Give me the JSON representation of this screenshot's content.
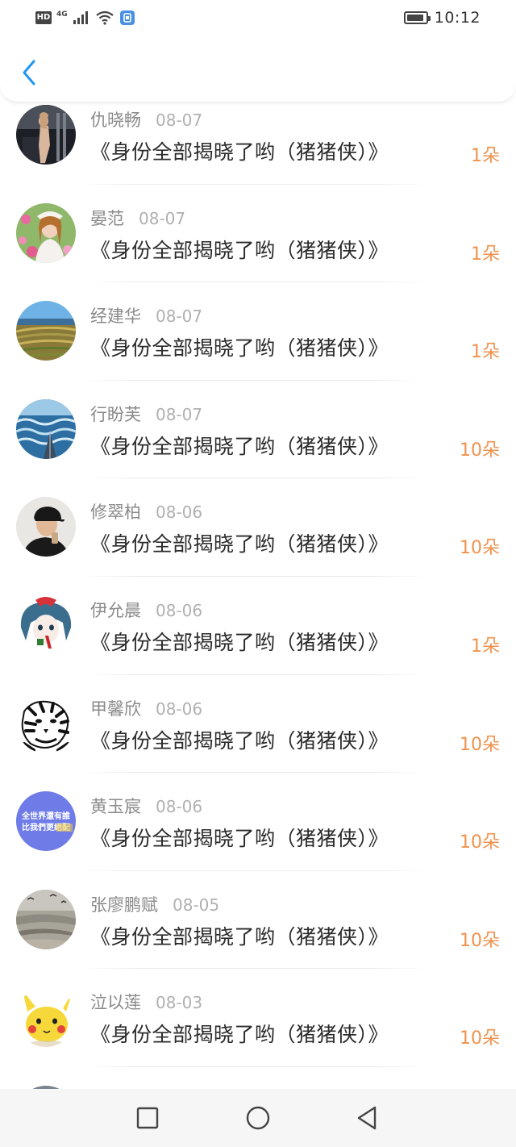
{
  "status_bar": {
    "hd_badge": "HD",
    "network_type": "4G",
    "time": "10:12",
    "battery_level_percent": 90,
    "icons": [
      "signal-icon",
      "wifi-icon",
      "app-notification-icon",
      "battery-icon"
    ]
  },
  "header": {
    "back_icon": "chevron-left-icon",
    "accent_color": "#2196F3"
  },
  "colors": {
    "amount": "#f0924c",
    "name": "#8a8a8a",
    "date": "#b0b0b0",
    "title": "#2b2b2b"
  },
  "gifts": [
    {
      "name": "仇晓畅",
      "date": "08-07",
      "title": "《身份全部揭晓了哟（猪猪侠）》",
      "amount": "1朵",
      "avatar": "gym-photo-avatar"
    },
    {
      "name": "晏范",
      "date": "08-07",
      "title": "《身份全部揭晓了哟（猪猪侠）》",
      "amount": "1朵",
      "avatar": "woman-flowers-avatar"
    },
    {
      "name": "经建华",
      "date": "08-07",
      "title": "《身份全部揭晓了哟（猪猪侠）》",
      "amount": "1朵",
      "avatar": "rice-terrace-avatar"
    },
    {
      "name": "行盼芙",
      "date": "08-07",
      "title": "《身份全部揭晓了哟（猪猪侠）》",
      "amount": "10朵",
      "avatar": "ocean-waves-avatar"
    },
    {
      "name": "修翠柏",
      "date": "08-06",
      "title": "《身份全部揭晓了哟（猪猪侠）》",
      "amount": "10朵",
      "avatar": "man-cap-avatar"
    },
    {
      "name": "伊允晨",
      "date": "08-06",
      "title": "《身份全部揭晓了哟（猪猪侠）》",
      "amount": "1朵",
      "avatar": "anime-character-avatar"
    },
    {
      "name": "甲馨欣",
      "date": "08-06",
      "title": "《身份全部揭晓了哟（猪猪侠）》",
      "amount": "10朵",
      "avatar": "tiger-sketch-avatar"
    },
    {
      "name": "黄玉宸",
      "date": "08-06",
      "title": "《身份全部揭晓了哟（猪猪侠）》",
      "amount": "10朵",
      "avatar": "text-image-avatar",
      "avatar_text": [
        "全世界還有誰",
        "比我們更絕配"
      ]
    },
    {
      "name": "张廖鹏赋",
      "date": "08-05",
      "title": "《身份全部揭晓了哟（猪猪侠）》",
      "amount": "10朵",
      "avatar": "beach-birds-avatar"
    },
    {
      "name": "泣以莲",
      "date": "08-03",
      "title": "《身份全部揭晓了哟（猪猪侠）》",
      "amount": "10朵",
      "avatar": "pikachu-avatar"
    }
  ],
  "nav_bar": {
    "buttons": [
      "recent-apps-button",
      "home-button",
      "back-button"
    ]
  }
}
